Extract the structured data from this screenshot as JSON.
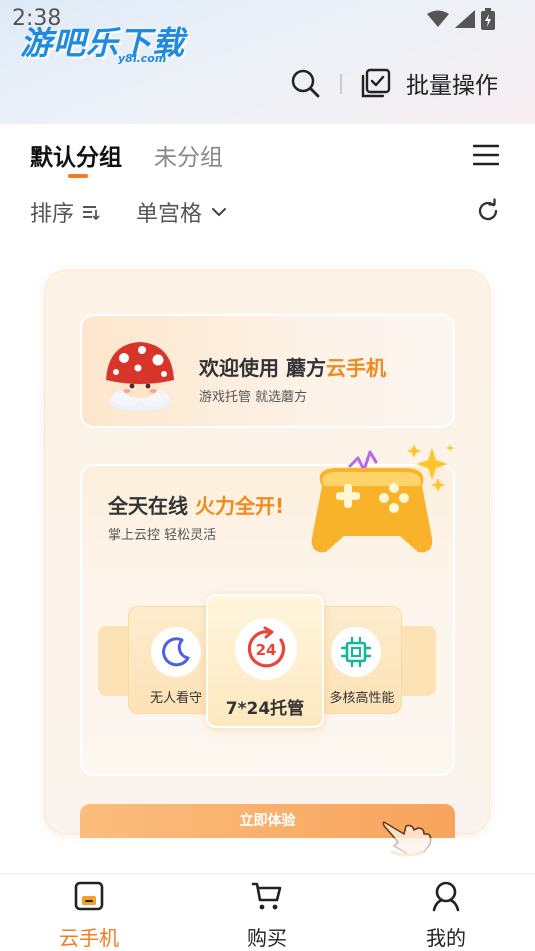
{
  "status_bar": {
    "time": "2:38"
  },
  "watermark": {
    "text": "游吧乐下载",
    "sub": "y8l.com"
  },
  "header": {
    "batch_label": "批量操作"
  },
  "tabs": [
    {
      "label": "默认分组",
      "active": true
    },
    {
      "label": "未分组",
      "active": false
    }
  ],
  "toolbar": {
    "sort_label": "排序",
    "view_label": "单宫格"
  },
  "welcome": {
    "title_prefix": "欢迎使用 蘑方",
    "title_accent": "云手机",
    "subtitle": "游戏托管  就选蘑方"
  },
  "feature": {
    "title_prefix": "全天在线 ",
    "title_accent": "火力全开!",
    "subtitle": "掌上云控  轻松灵活"
  },
  "features": [
    {
      "label": "无人看守",
      "icon": "moon-icon"
    },
    {
      "label": "7*24托管",
      "icon": "clock-24-icon"
    },
    {
      "label": "多核高性能",
      "icon": "chip-icon"
    }
  ],
  "cta": {
    "label": "立即体验"
  },
  "bottom_nav": [
    {
      "label": "云手机",
      "icon": "cloud-phone-icon",
      "active": true
    },
    {
      "label": "购买",
      "icon": "cart-icon",
      "active": false
    },
    {
      "label": "我的",
      "icon": "profile-icon",
      "active": false
    }
  ],
  "colors": {
    "accent": "#f57c1f",
    "text": "#222222",
    "muted": "#888888"
  }
}
